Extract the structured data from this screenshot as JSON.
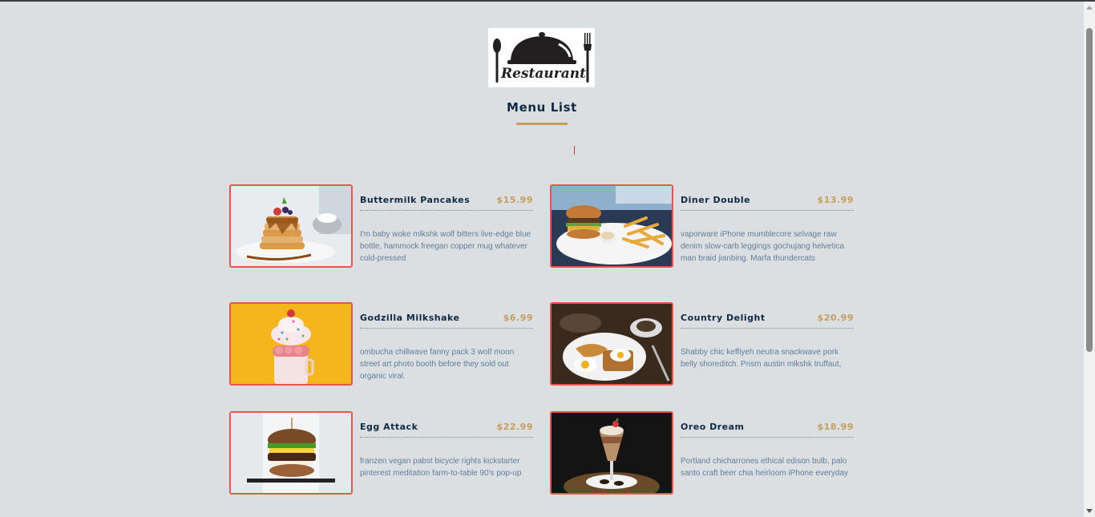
{
  "logo": {
    "text": "Restaurant",
    "icon": "cloche-spoon-fork-icon"
  },
  "page_title": "Menu List",
  "colors": {
    "accent": "#c59d5f",
    "title": "#102a43",
    "border": "#e4574a",
    "text": "#617d98",
    "background": "#dcdfe2"
  },
  "menu": [
    {
      "name": "Buttermilk Pancakes",
      "price": "$15.99",
      "desc": "I'm baby woke mlkshk wolf bitters live-edge blue bottle, hammock freegan copper mug whatever cold-pressed",
      "photo": "pancakes-photo"
    },
    {
      "name": "Diner Double",
      "price": "$13.99",
      "desc": "vaporware iPhone mumblecore selvage raw denim slow-carb leggings gochujang helvetica man braid jianbing. Marfa thundercats",
      "photo": "burger-fries-photo"
    },
    {
      "name": "Godzilla Milkshake",
      "price": "$6.99",
      "desc": "ombucha chillwave fanny pack 3 wolf moon street art photo booth before they sold out organic viral.",
      "photo": "milkshake-photo"
    },
    {
      "name": "Country Delight",
      "price": "$20.99",
      "desc": "Shabby chic keffiyeh neutra snackwave pork belly shoreditch. Prism austin mlkshk truffaut,",
      "photo": "eggs-toast-photo"
    },
    {
      "name": "Egg Attack",
      "price": "$22.99",
      "desc": "franzen vegan pabst bicycle rights kickstarter pinterest meditation farm-to-table 90's pop-up",
      "photo": "egg-burger-photo"
    },
    {
      "name": "Oreo Dream",
      "price": "$18.99",
      "desc": "Portland chicharrones ethical edison bulb, palo santo craft beer chia heirloom iPhone everyday",
      "photo": "oreo-shake-photo"
    }
  ]
}
